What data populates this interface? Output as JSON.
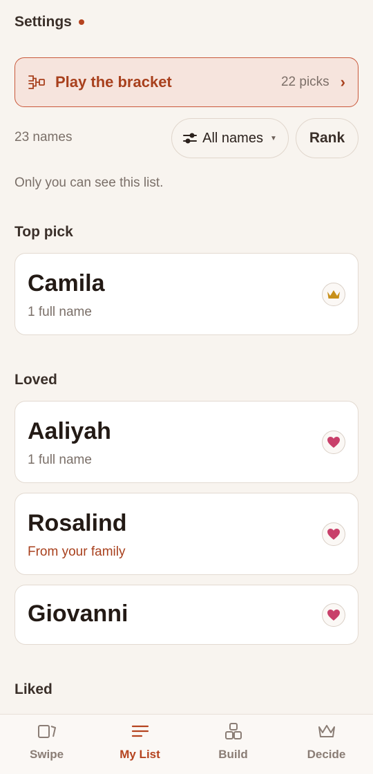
{
  "header": {
    "settings_label": "Settings"
  },
  "bracket": {
    "title": "Play the bracket",
    "picks": "22 picks",
    "chevron": "›"
  },
  "list_controls": {
    "count": "23 names",
    "filter_label": "All names",
    "rank_label": "Rank"
  },
  "privacy_note": "Only you can see this list.",
  "sections": {
    "top_pick": {
      "title": "Top pick",
      "items": [
        {
          "name": "Camila",
          "sub": "1 full name",
          "badge": "crown-icon"
        }
      ]
    },
    "loved": {
      "title": "Loved",
      "items": [
        {
          "name": "Aaliyah",
          "sub": "1 full name",
          "badge": "heart-icon"
        },
        {
          "name": "Rosalind",
          "sub": "From your family",
          "badge": "heart-icon"
        },
        {
          "name": "Giovanni",
          "sub": "",
          "badge": "heart-icon"
        }
      ]
    },
    "liked": {
      "title": "Liked"
    }
  },
  "bottom_nav": [
    {
      "label": "Swipe",
      "icon": "swipe-cards-icon",
      "active": false
    },
    {
      "label": "My List",
      "icon": "list-icon",
      "active": true
    },
    {
      "label": "Build",
      "icon": "blocks-icon",
      "active": false
    },
    {
      "label": "Decide",
      "icon": "crown-icon",
      "active": false
    }
  ],
  "colors": {
    "background": "#f8f4ef",
    "accent": "#b5431f",
    "bracket_bg": "#f6e4dd",
    "crown": "#c8901a",
    "heart": "#c8406a"
  }
}
